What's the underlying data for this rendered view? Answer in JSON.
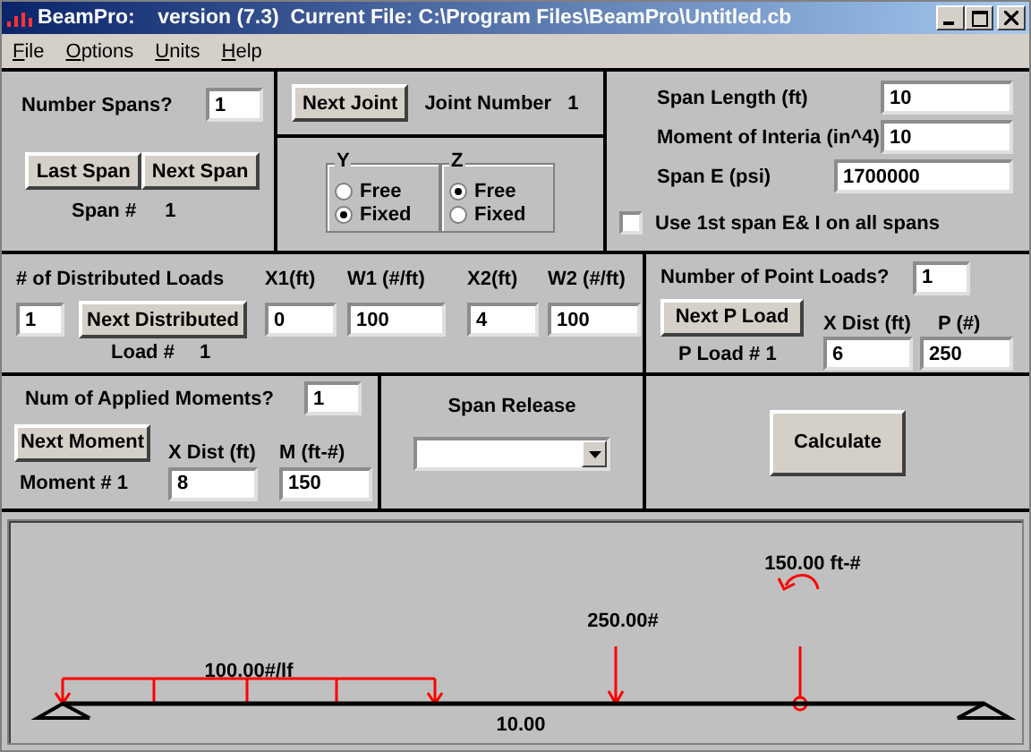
{
  "window": {
    "title": "BeamPro:    version (7.3)  Current File: C:\\Program Files\\BeamPro\\Untitled.cb"
  },
  "menu": [
    {
      "label": "File"
    },
    {
      "label": "Options"
    },
    {
      "label": "Units"
    },
    {
      "label": "Help"
    }
  ],
  "spans": {
    "label": "Number Spans?",
    "value": "1",
    "buttons": [
      "Last Span",
      "Next Span"
    ],
    "span_label": "Span #",
    "span_number": "1"
  },
  "joint": {
    "button": "Next Joint",
    "label": "Joint Number",
    "number": "1"
  },
  "supports": [
    {
      "axis": "Y",
      "options": [
        {
          "label": "Free",
          "selected": false
        },
        {
          "label": "Fixed",
          "selected": true
        }
      ]
    },
    {
      "axis": "Z",
      "options": [
        {
          "label": "Free",
          "selected": true
        },
        {
          "label": "Fixed",
          "selected": false
        }
      ]
    }
  ],
  "span_properties": {
    "fields": [
      {
        "label": "Span Length (ft)",
        "value": "10"
      },
      {
        "label": "Moment of Interia (in^4)",
        "value": "10"
      },
      {
        "label": "Span E (psi)",
        "value": "1700000"
      }
    ],
    "checkbox": {
      "label": "Use 1st span E& I on all spans",
      "checked": false
    }
  },
  "distributed_loads": {
    "label": "# of Distributed Loads",
    "count": "1",
    "button": "Next Distributed",
    "load_label": "Load #",
    "load_number": "1",
    "columns": [
      {
        "label": "X1(ft)",
        "value": "0"
      },
      {
        "label": "W1 (#/ft)",
        "value": "100"
      },
      {
        "label": "X2(ft)",
        "value": "4"
      },
      {
        "label": "W2 (#/ft)",
        "value": "100"
      }
    ]
  },
  "point_loads": {
    "label": "Number of Point Loads?",
    "count": "1",
    "button": "Next P Load",
    "load_label": "P Load # 1",
    "columns": [
      {
        "label": "X Dist (ft)",
        "value": "6"
      },
      {
        "label": "P (#)",
        "value": "250"
      }
    ]
  },
  "moments": {
    "label": "Num of Applied Moments?",
    "count": "1",
    "button": "Next Moment",
    "moment_label": "Moment # 1",
    "columns": [
      {
        "label": "X Dist (ft)",
        "value": "8"
      },
      {
        "label": "M (ft-#)",
        "value": "150"
      }
    ]
  },
  "span_release": {
    "label": "Span Release"
  },
  "calculate": {
    "label": "Calculate"
  },
  "diagram": {
    "distributed_label": "100.00#/lf",
    "point_label": "250.00#",
    "moment_label": "150.00 ft-#",
    "span_label": "10.00"
  }
}
